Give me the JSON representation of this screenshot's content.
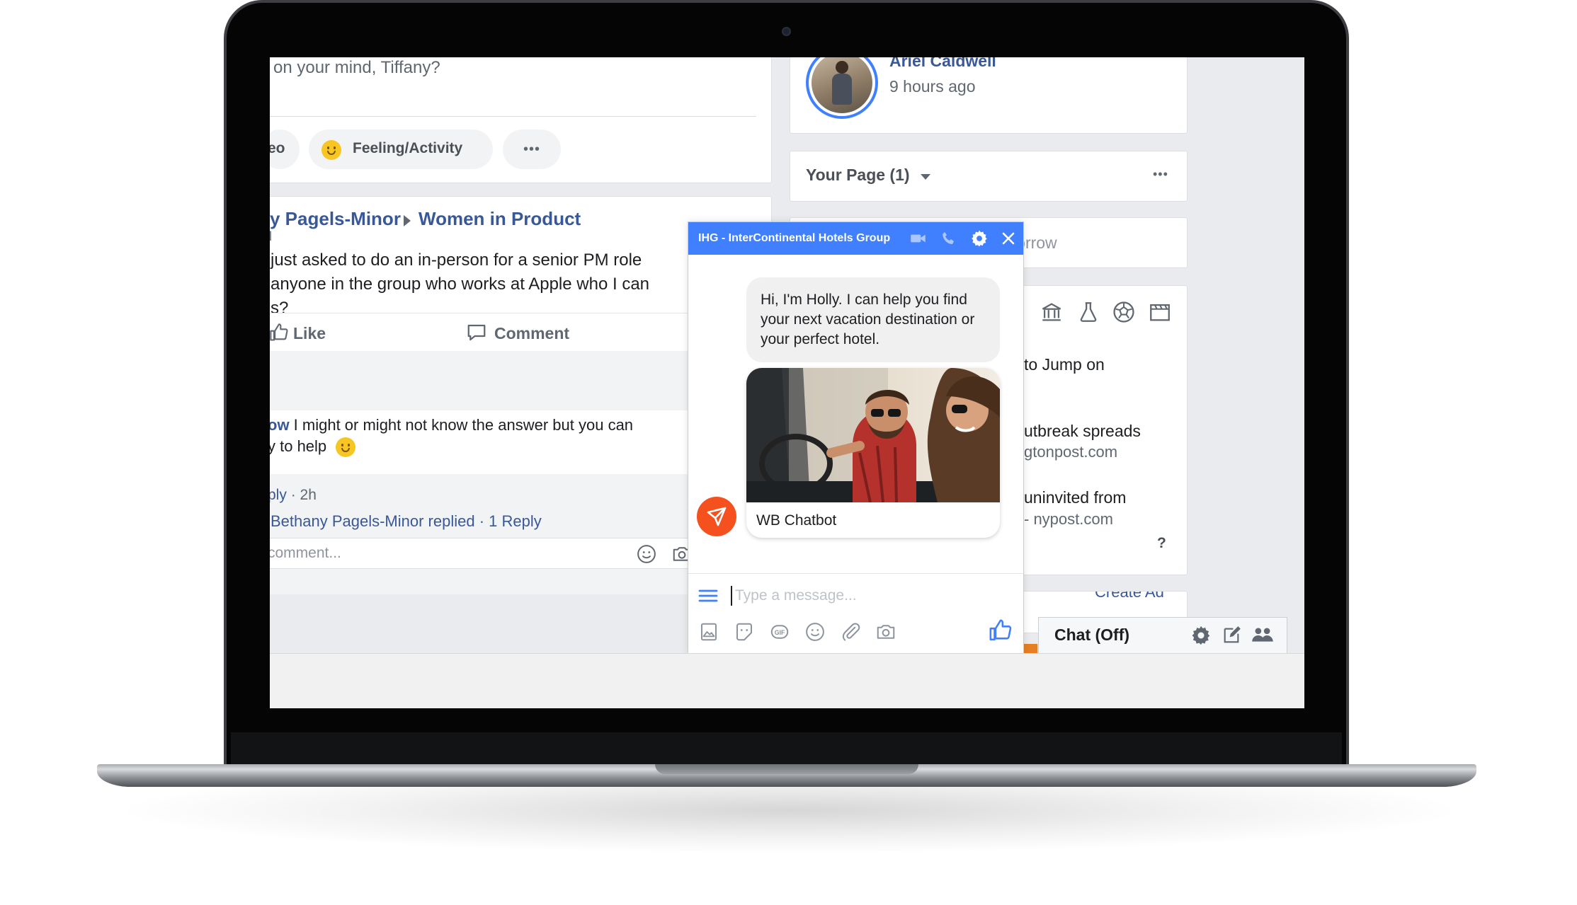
{
  "composer": {
    "prompt": "on your mind, Tiffany?",
    "video_label_fragment": "eo",
    "feeling_label": "Feeling/Activity",
    "more_label": "•••"
  },
  "post": {
    "author_fragment": "y Pagels-Minor",
    "group": "Women in Product",
    "meta_fragment": "l",
    "lines": [
      " just asked to do an in-person for a senior PM role",
      "anyone in the group who works at Apple who I can",
      "s?"
    ],
    "like_label": "Like",
    "comment_label": "Comment"
  },
  "comment": {
    "author_fragment": "ow",
    "line1": " I might or might not know the answer but you can",
    "line2": "y to help",
    "reply_label": "ply",
    "time": " · 2h",
    "replied_text": "Bethany Pagels-Minor replied",
    "reply_count": " · 1 Reply",
    "input_placeholder": "comment..."
  },
  "right": {
    "profile_name": "Ariel Caldwell",
    "profile_time": "9 hours ago",
    "your_page_label": "Your Page (1)",
    "your_page_more": "•••",
    "birthday_fragment": "morrow",
    "news": [
      {
        "title": "to Jump on",
        "source": ""
      },
      {
        "title": "utbreak spreads",
        "source": "gtonpost.com"
      },
      {
        "title": "uninvited from",
        "source": "- nypost.com"
      }
    ],
    "help_fragment": "?",
    "create_ad_fragment": "Create Ad"
  },
  "chat": {
    "title": "IHG - InterContinental Hotels Group",
    "message": "Hi, I'm Holly. I can help you find your next vacation destination or your perfect hotel.",
    "card_caption": "WB Chatbot",
    "input_placeholder": "Type a message...",
    "accent_color": "#4080ff",
    "bot_color": "#f4511e"
  },
  "chat_dock": {
    "label": "Chat (Off)"
  }
}
